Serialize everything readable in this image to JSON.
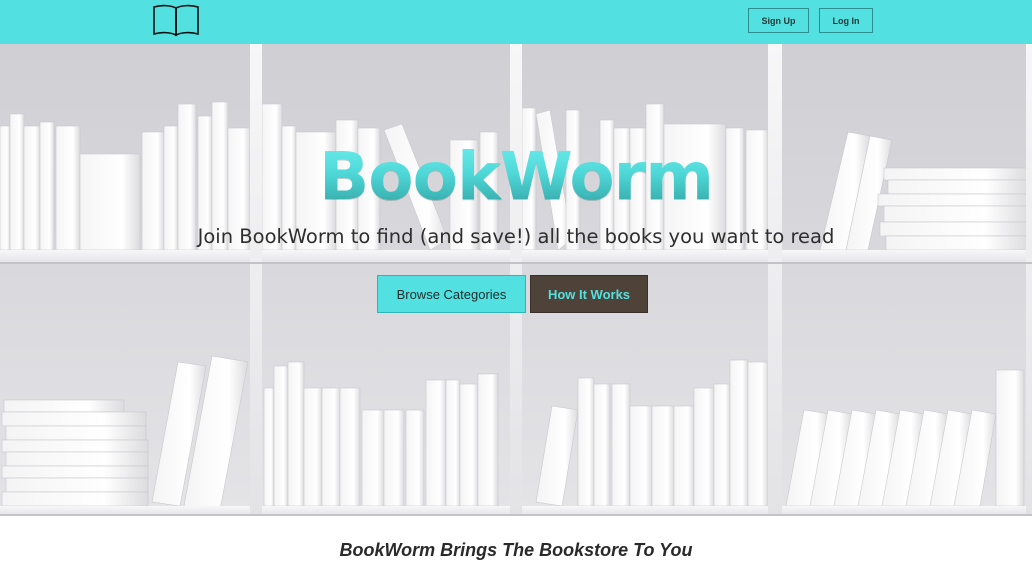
{
  "header": {
    "logo_icon": "open-book-icon",
    "signup_label": "Sign Up",
    "login_label": "Log In",
    "accent_color": "#53e0e0"
  },
  "hero": {
    "title": "BookWorm",
    "subtitle": "Join BookWorm to find (and save!) all the books you want to read",
    "background": "white bookshelf with white books",
    "browse_label": "Browse Categories",
    "how_label": "How It Works",
    "how_color": "#4e4239"
  },
  "section": {
    "tagline": "BookWorm Brings The Bookstore To You"
  }
}
